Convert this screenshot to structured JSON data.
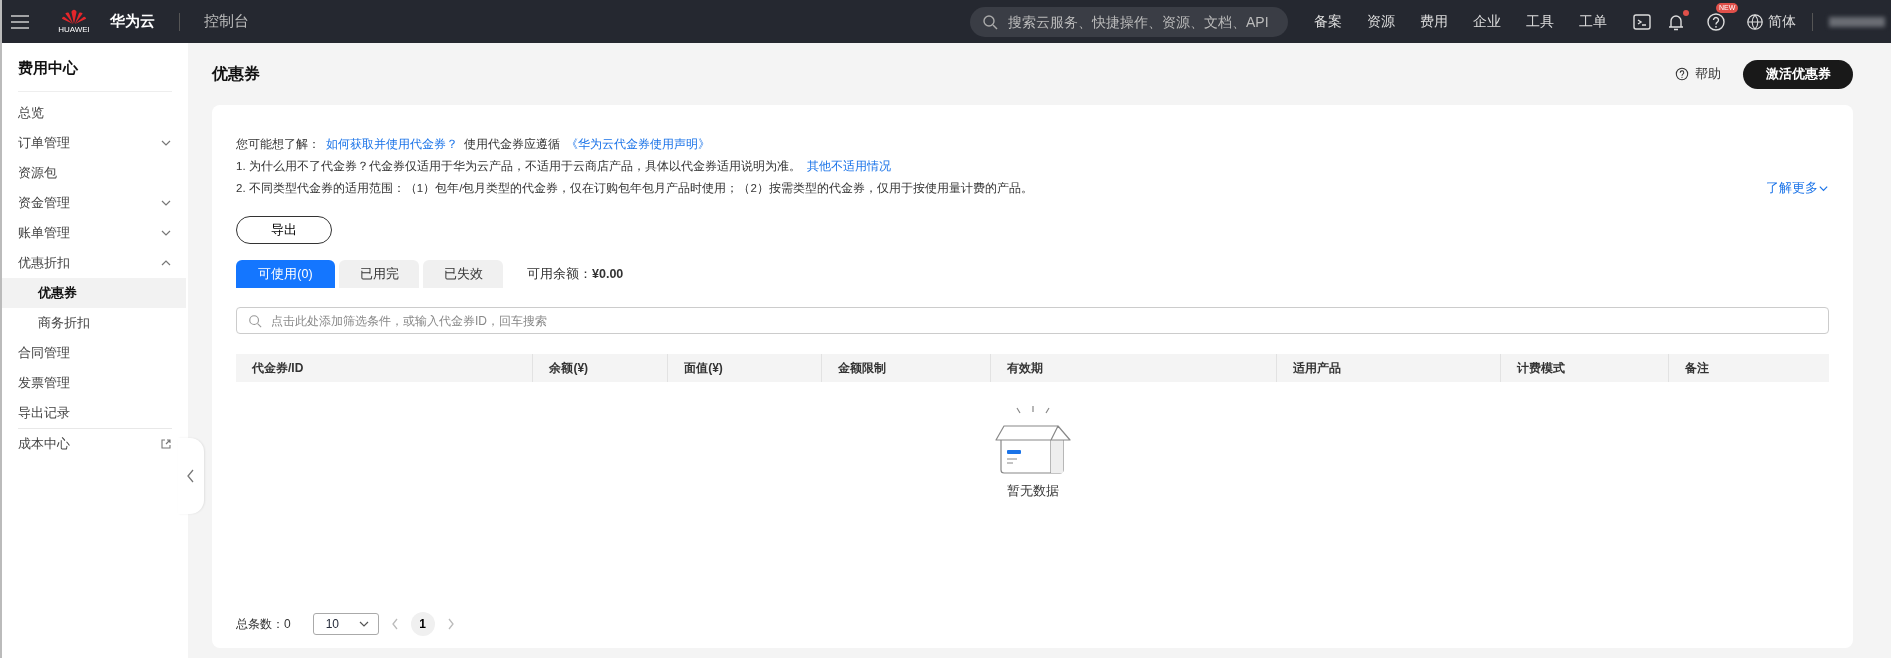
{
  "topbar": {
    "brand": "华为云",
    "logo_text": "HUAWEI",
    "console": "控制台",
    "search": {
      "placeholder": "搜索云服务、快捷操作、资源、文档、API"
    },
    "nav": [
      "备案",
      "资源",
      "费用",
      "企业",
      "工具",
      "工单"
    ],
    "bell_unread": true,
    "help_badge": "NEW",
    "language": "简体"
  },
  "sidebar": {
    "title": "费用中心",
    "items": [
      {
        "label": "总览",
        "selected": false
      },
      {
        "label": "订单管理",
        "selected": false,
        "expanded": false
      },
      {
        "label": "资源包",
        "selected": false
      },
      {
        "label": "资金管理",
        "selected": false,
        "expanded": false
      },
      {
        "label": "账单管理",
        "selected": false,
        "expanded": false
      },
      {
        "label": "优惠折扣",
        "selected": false,
        "expanded": true,
        "children": [
          {
            "label": "优惠券",
            "selected": true
          },
          {
            "label": "商务折扣",
            "selected": false
          }
        ]
      },
      {
        "label": "合同管理",
        "selected": false
      },
      {
        "label": "发票管理",
        "selected": false
      },
      {
        "label": "导出记录",
        "selected": false
      },
      {
        "label": "成本中心",
        "selected": false,
        "external": true
      }
    ]
  },
  "page": {
    "title": "优惠券",
    "help": "帮助",
    "primary_button": "激活优惠券"
  },
  "info": {
    "lines": [
      [
        {
          "kind": "text",
          "text": "您可能想了解："
        },
        {
          "kind": "link",
          "text": "如何获取并使用代金券？"
        },
        {
          "kind": "text",
          "text": "使用代金券应遵循"
        },
        {
          "kind": "link",
          "text": "《华为云代金券使用声明》"
        }
      ],
      [
        {
          "kind": "text",
          "text": "1. 为什么用不了代金券？代金券仅适用于华为云产品，不适用于云商店产品，具体以代金券适用说明为准。"
        },
        {
          "kind": "link",
          "text": "其他不适用情况"
        }
      ],
      [
        {
          "kind": "text",
          "text": "2. 不同类型代金券的适用范围：（1）包年/包月类型的代金券，仅在订购包年包月产品时使用；（2）按需类型的代金券，仅用于按使用量计费的产品。"
        }
      ]
    ],
    "more": "了解更多"
  },
  "export_button": "导出",
  "tabs": [
    {
      "label": "可使用(0)",
      "selected": true
    },
    {
      "label": "已用完",
      "selected": false
    },
    {
      "label": "已失效",
      "selected": false
    }
  ],
  "balance": {
    "label": "可用余额：",
    "value": "¥0.00"
  },
  "filter": {
    "placeholder": "点击此处添加筛选条件，或输入代金券ID，回车搜索"
  },
  "table": {
    "columns": [
      "代金券/ID",
      "余额(¥)",
      "面值(¥)",
      "金额限制",
      "有效期",
      "适用产品",
      "计费模式",
      "备注"
    ],
    "empty": "暂无数据"
  },
  "pagination": {
    "total_label": "总条数：",
    "total": "0",
    "page_size": "10",
    "pages": [
      {
        "label": "1",
        "selected": true
      }
    ]
  }
}
